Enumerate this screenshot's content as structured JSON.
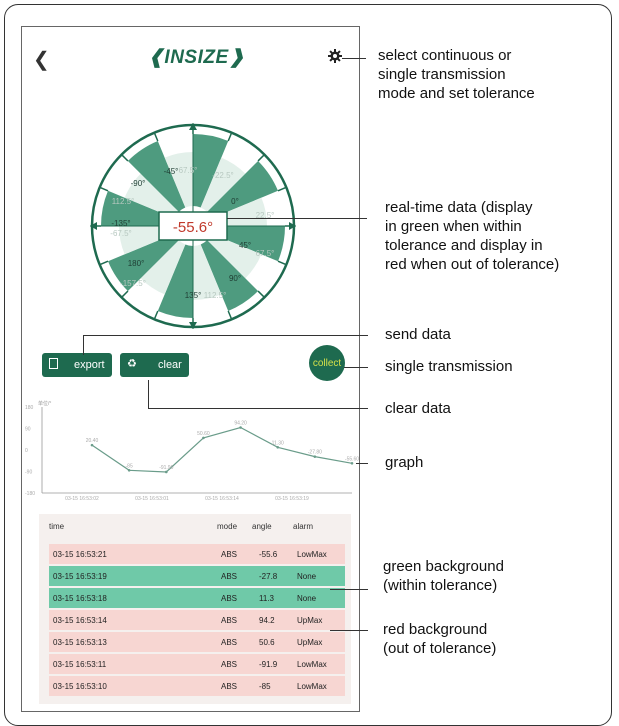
{
  "header": {
    "back_icon": "chevron-left-icon",
    "logo_text": "INSIZE",
    "settings_icon": "gear-icon"
  },
  "dial": {
    "reading": "-55.6°",
    "labels": [
      "-90°",
      "-45°",
      "0°",
      "45°",
      "90°",
      "135°",
      "180°",
      "-135°"
    ],
    "faint_labels": [
      "67.5°",
      "-22.5°",
      "112.5°",
      "22.5°",
      "-157.5°",
      "67.5°",
      "-67.5°",
      "112.5°"
    ]
  },
  "actions": {
    "export_label": "export",
    "clear_label": "clear",
    "collect_label": "collect"
  },
  "graph": {
    "y_unit": "单位/°",
    "y_ticks": [
      "180",
      "90",
      "0",
      "-90",
      "-180"
    ],
    "x_ticks": [
      "03-15 16:53:02",
      "03-15 16:53:01",
      "03-15 16:53:14",
      "03-15 16:53:19"
    ],
    "point_labels": [
      "20.40",
      "-85",
      "-91.90",
      "50.60",
      "94.20",
      "11.30",
      "-27.80",
      "-55.60"
    ]
  },
  "chart_data": {
    "type": "line",
    "x": [
      "03-15 16:53:02",
      "03-15 16:53:10",
      "03-15 16:53:11",
      "03-15 16:53:13",
      "03-15 16:53:14",
      "03-15 16:53:18",
      "03-15 16:53:19",
      "03-15 16:53:21"
    ],
    "values": [
      20.4,
      -85,
      -91.9,
      50.6,
      94.2,
      11.3,
      -27.8,
      -55.6
    ],
    "ylim": [
      -180,
      180
    ],
    "ylabel": "单位/°"
  },
  "table": {
    "headers": {
      "time": "time",
      "mode": "mode",
      "angle": "angle",
      "alarm": "alarm"
    },
    "rows": [
      {
        "time": "03-15 16:53:21",
        "mode": "ABS",
        "angle": "-55.6",
        "alarm": "LowMax",
        "status": "red"
      },
      {
        "time": "03-15 16:53:19",
        "mode": "ABS",
        "angle": "-27.8",
        "alarm": "None",
        "status": "green"
      },
      {
        "time": "03-15 16:53:18",
        "mode": "ABS",
        "angle": "11.3",
        "alarm": "None",
        "status": "green"
      },
      {
        "time": "03-15 16:53:14",
        "mode": "ABS",
        "angle": "94.2",
        "alarm": "UpMax",
        "status": "red"
      },
      {
        "time": "03-15 16:53:13",
        "mode": "ABS",
        "angle": "50.6",
        "alarm": "UpMax",
        "status": "red"
      },
      {
        "time": "03-15 16:53:11",
        "mode": "ABS",
        "angle": "-91.9",
        "alarm": "LowMax",
        "status": "red"
      },
      {
        "time": "03-15 16:53:10",
        "mode": "ABS",
        "angle": "-85",
        "alarm": "LowMax",
        "status": "red"
      }
    ]
  },
  "annotations": {
    "settings": [
      "select continuous or",
      "single transmission",
      "mode and set tolerance"
    ],
    "realtime": [
      "real-time data (display",
      "in green when within",
      "tolerance and display in",
      "red when out of tolerance)"
    ],
    "send": "send data",
    "single": "single transmission",
    "clear": "clear data",
    "graph": "graph",
    "green": [
      "green background",
      "(within tolerance)"
    ],
    "red": [
      "red background",
      "(out of tolerance)"
    ]
  },
  "colors": {
    "brand": "#1e6a4f",
    "green_row": "#6fc9a8",
    "red_row": "#f7d6d2",
    "reading_red": "#c0392b",
    "collect_text": "#d4e04a"
  }
}
